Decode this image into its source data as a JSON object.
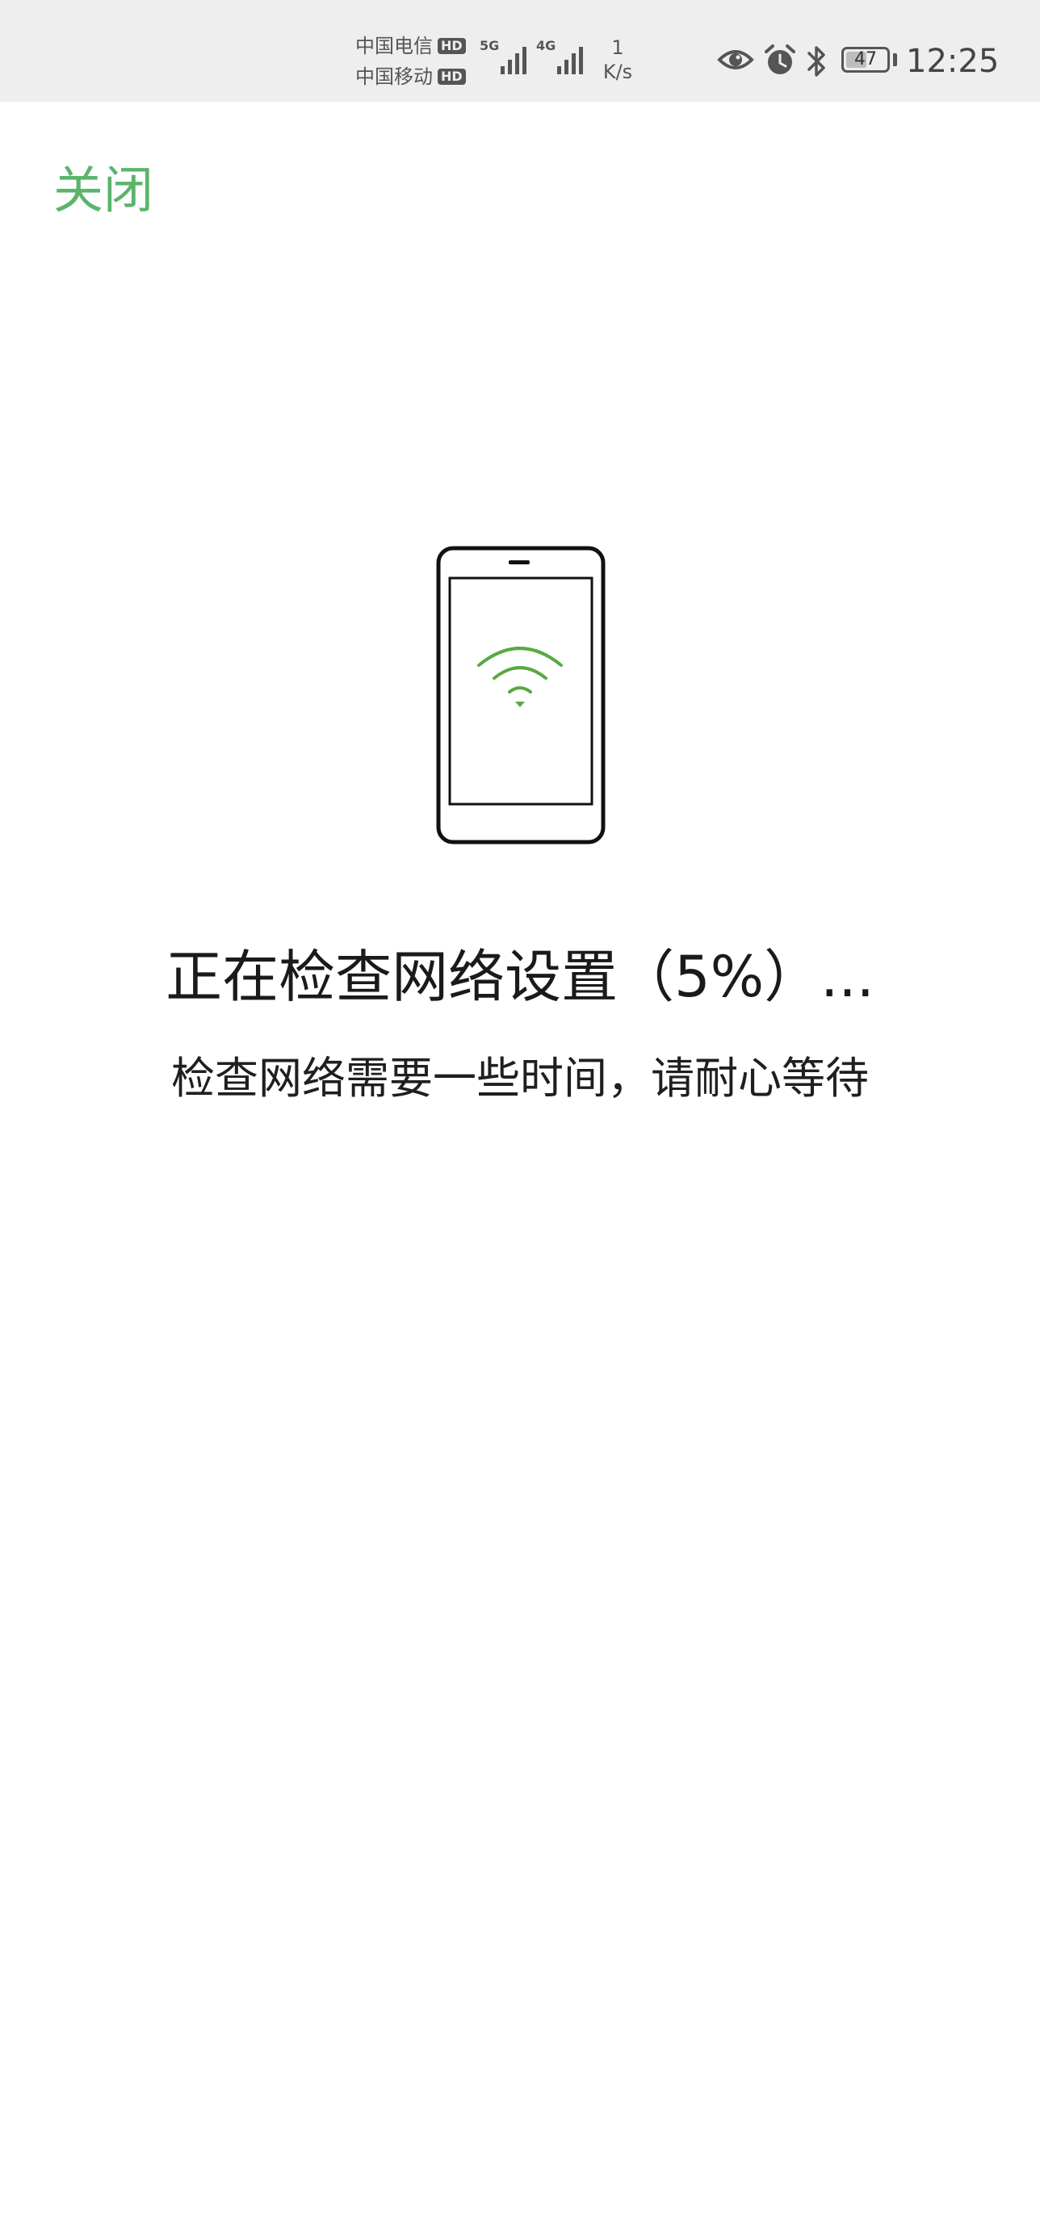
{
  "status_bar": {
    "carrier_1": "中国电信",
    "carrier_2": "中国移动",
    "hd_badge": "HD",
    "net_type_1": "5G",
    "net_type_2": "4G",
    "speed_value": "1",
    "speed_unit": "K/s",
    "battery_level": "47",
    "time": "12:25",
    "icons": [
      "eye-icon",
      "alarm-icon",
      "bluetooth-icon",
      "battery-icon"
    ]
  },
  "header": {
    "close_label": "关闭"
  },
  "illustration": {
    "icon": "phone-wifi-icon",
    "accent_color": "#5aa843"
  },
  "main": {
    "title": "正在检查网络设置（5%）...",
    "subtitle": "检查网络需要一些时间，请耐心等待"
  },
  "colors": {
    "close_link": "#5ab56b",
    "status_bar_bg": "#eeeeee",
    "text": "#1a1a1a"
  }
}
